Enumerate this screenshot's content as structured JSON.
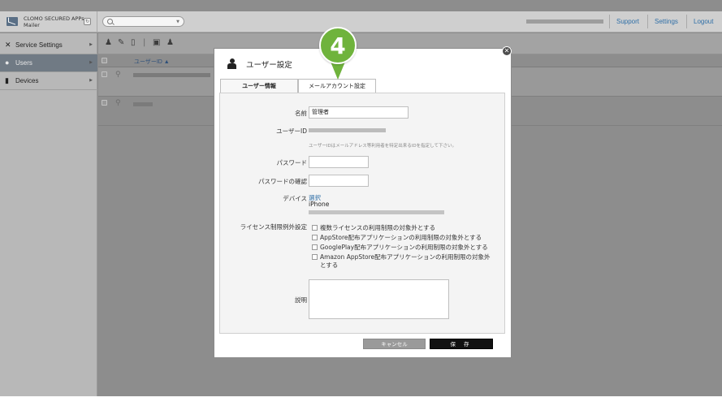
{
  "app": {
    "name": "CLOMO SECURED APPs\nMailer",
    "badge_icon": "refresh-icon"
  },
  "topbar": {
    "links": [
      "Support",
      "Settings",
      "Logout"
    ],
    "search_placeholder": ""
  },
  "sidebar": {
    "items": [
      {
        "label": "Service Settings",
        "icon": "tools-icon"
      },
      {
        "label": "Users",
        "icon": "user-icon",
        "active": true
      },
      {
        "label": "Devices",
        "icon": "device-icon"
      }
    ]
  },
  "list": {
    "column_header": "ユーザーID ▲",
    "toolbar_icons": [
      "add-user-icon",
      "edit-icon",
      "delete-icon",
      "import-icon",
      "export-user-icon"
    ]
  },
  "modal": {
    "title": "ユーザー設定",
    "tabs": [
      "ユーザー情報",
      "メールアカウント設定"
    ],
    "fields": {
      "name_label": "名前",
      "name_value": "管理者",
      "userid_label": "ユーザーID",
      "userid_hint": "ユーザーIDはメールアドレス等利用者を特定出来るIDを指定して下さい。",
      "password_label": "パスワード",
      "password_confirm_label": "パスワードの確認",
      "device_label": "デバイス",
      "device_select": "選択",
      "device_value": "iPhone",
      "license_label": "ライセンス制限例外設定",
      "license_options": [
        "複数ライセンスの利用制限の対象外とする",
        "AppStore配布アプリケーションの利用制限の対象外とする",
        "GooglePlay配布アプリケーションの利用制限の対象外とする",
        "Amazon AppStore配布アプリケーションの利用制限の対象外とする"
      ],
      "description_label": "説明"
    },
    "buttons": {
      "cancel": "キャンセル",
      "save": "保 存"
    }
  },
  "callout": {
    "number": "4",
    "color": "#6fb33c"
  },
  "colors": {
    "link": "#2f6fa7",
    "active_sidebar": "#707a84",
    "overlay": "#8d8d8d"
  }
}
